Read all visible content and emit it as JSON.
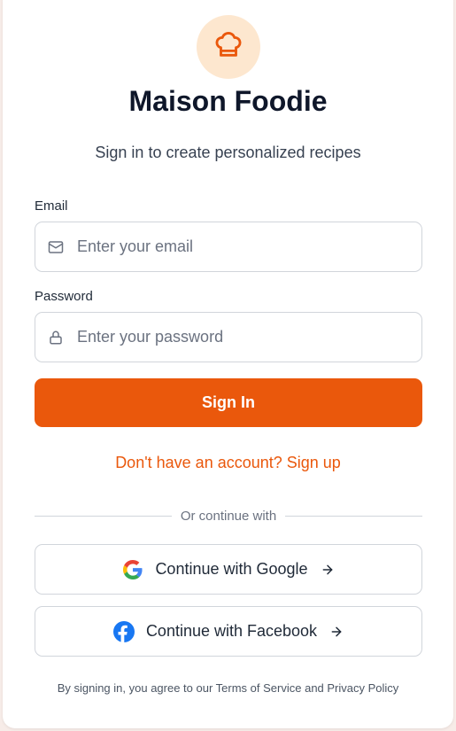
{
  "app": {
    "title": "Maison Foodie",
    "subtitle": "Sign in to create personalized recipes",
    "brand_color": "#ea580c",
    "logo_icon": "chef-hat-icon"
  },
  "form": {
    "email": {
      "label": "Email",
      "placeholder": "Enter your email",
      "value": "",
      "icon": "mail-icon"
    },
    "password": {
      "label": "Password",
      "placeholder": "Enter your password",
      "value": "",
      "icon": "lock-icon"
    },
    "submit_label": "Sign In",
    "signup_link": "Don't have an account? Sign up"
  },
  "divider": {
    "text": "Or continue with"
  },
  "social": {
    "google": {
      "label": "Continue with Google",
      "icon": "google-icon"
    },
    "facebook": {
      "label": "Continue with Facebook",
      "icon": "facebook-icon"
    }
  },
  "footer": {
    "terms": "By signing in, you agree to our Terms of Service and Privacy Policy"
  }
}
